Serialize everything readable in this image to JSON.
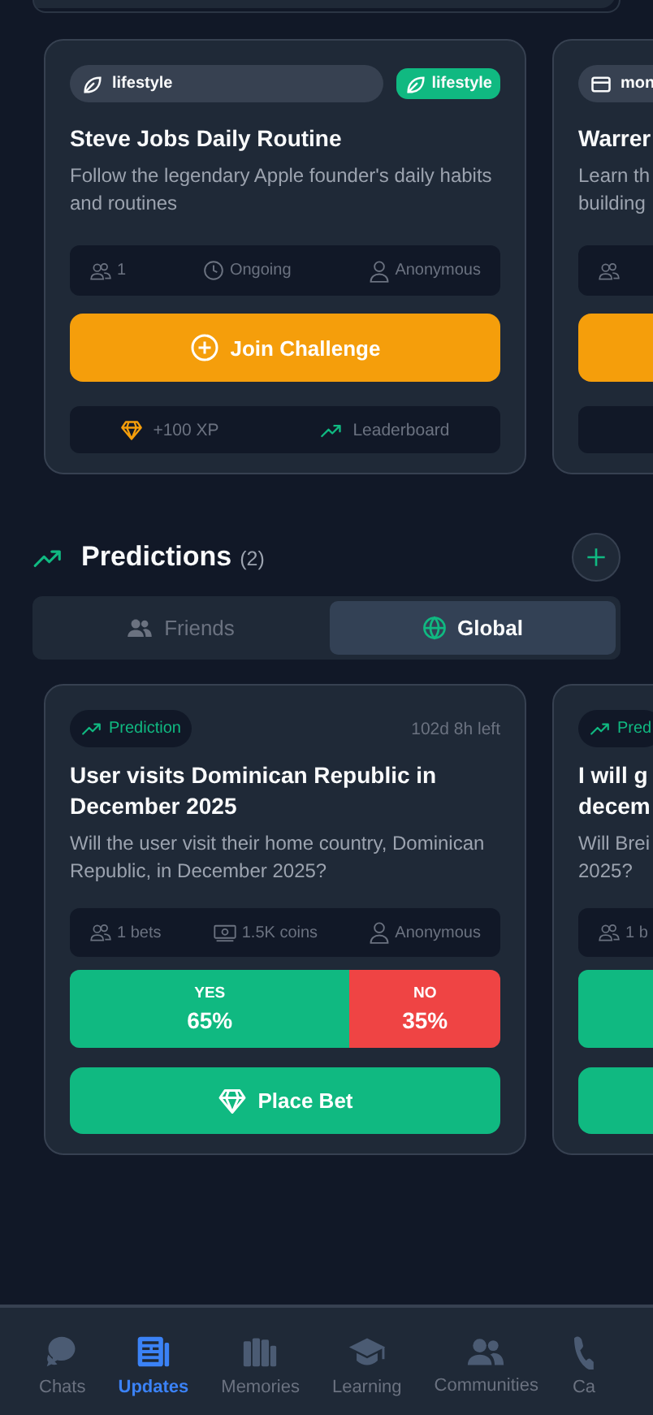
{
  "challenges": [
    {
      "category": {
        "kind": "leaf",
        "label": "lifestyle"
      },
      "tag": "lifestyle",
      "title": "Steve Jobs Daily Routine",
      "description": "Follow the legendary Apple founder's daily habits and routines",
      "meta": [
        {
          "kind": "participants",
          "label": "1"
        },
        {
          "kind": "time",
          "label": "Ongoing"
        },
        {
          "kind": "creator",
          "label": "Anonymous"
        }
      ],
      "action": "Join Challenge",
      "reward": "+100 XP",
      "leaderboard": "Leaderboard"
    },
    {
      "category": {
        "kind": "card",
        "label": "mon"
      },
      "title": "Warrer",
      "description": "Learn th\nbuilding",
      "meta": [
        {
          "kind": "participants"
        }
      ]
    }
  ],
  "predictions_header": {
    "title": "Predictions",
    "count": "(2)"
  },
  "tabs": [
    {
      "kind": "friends",
      "label": "Friends",
      "selected": false
    },
    {
      "kind": "global",
      "label": "Global",
      "selected": true
    }
  ],
  "predictions": [
    {
      "badge": "Prediction",
      "time_left": "102d 8h left",
      "title": "User visits Dominican Republic in December 2025",
      "description": "Will the user visit their home country, Dominican Republic, in December 2025?",
      "meta": [
        {
          "kind": "participants",
          "label": "1 bets"
        },
        {
          "kind": "coins",
          "label": "1.5K coins"
        },
        {
          "kind": "creator",
          "label": "Anonymous"
        }
      ],
      "odds": [
        {
          "kind": "yes",
          "label": "YES",
          "percent": "65%",
          "level": 0.65
        },
        {
          "kind": "no",
          "label": "NO",
          "percent": "35%"
        }
      ],
      "action": "Place Bet"
    },
    {
      "badge": "Pred",
      "title": "I will g\ndecem",
      "description": "Will Brei\n2025?",
      "meta": [
        {
          "kind": "participants",
          "label": "1 b"
        }
      ],
      "odds": [
        {
          "kind": "yes"
        }
      ]
    }
  ],
  "nav": [
    {
      "kind": "chats",
      "label": "Chats",
      "selected": false
    },
    {
      "kind": "updates",
      "label": "Updates",
      "selected": true
    },
    {
      "kind": "memories",
      "label": "Memories",
      "selected": false
    },
    {
      "kind": "learning",
      "label": "Learning",
      "selected": false
    },
    {
      "kind": "communities",
      "label": "Communities",
      "selected": false
    },
    {
      "kind": "calls",
      "label": "Ca",
      "selected": false
    }
  ]
}
